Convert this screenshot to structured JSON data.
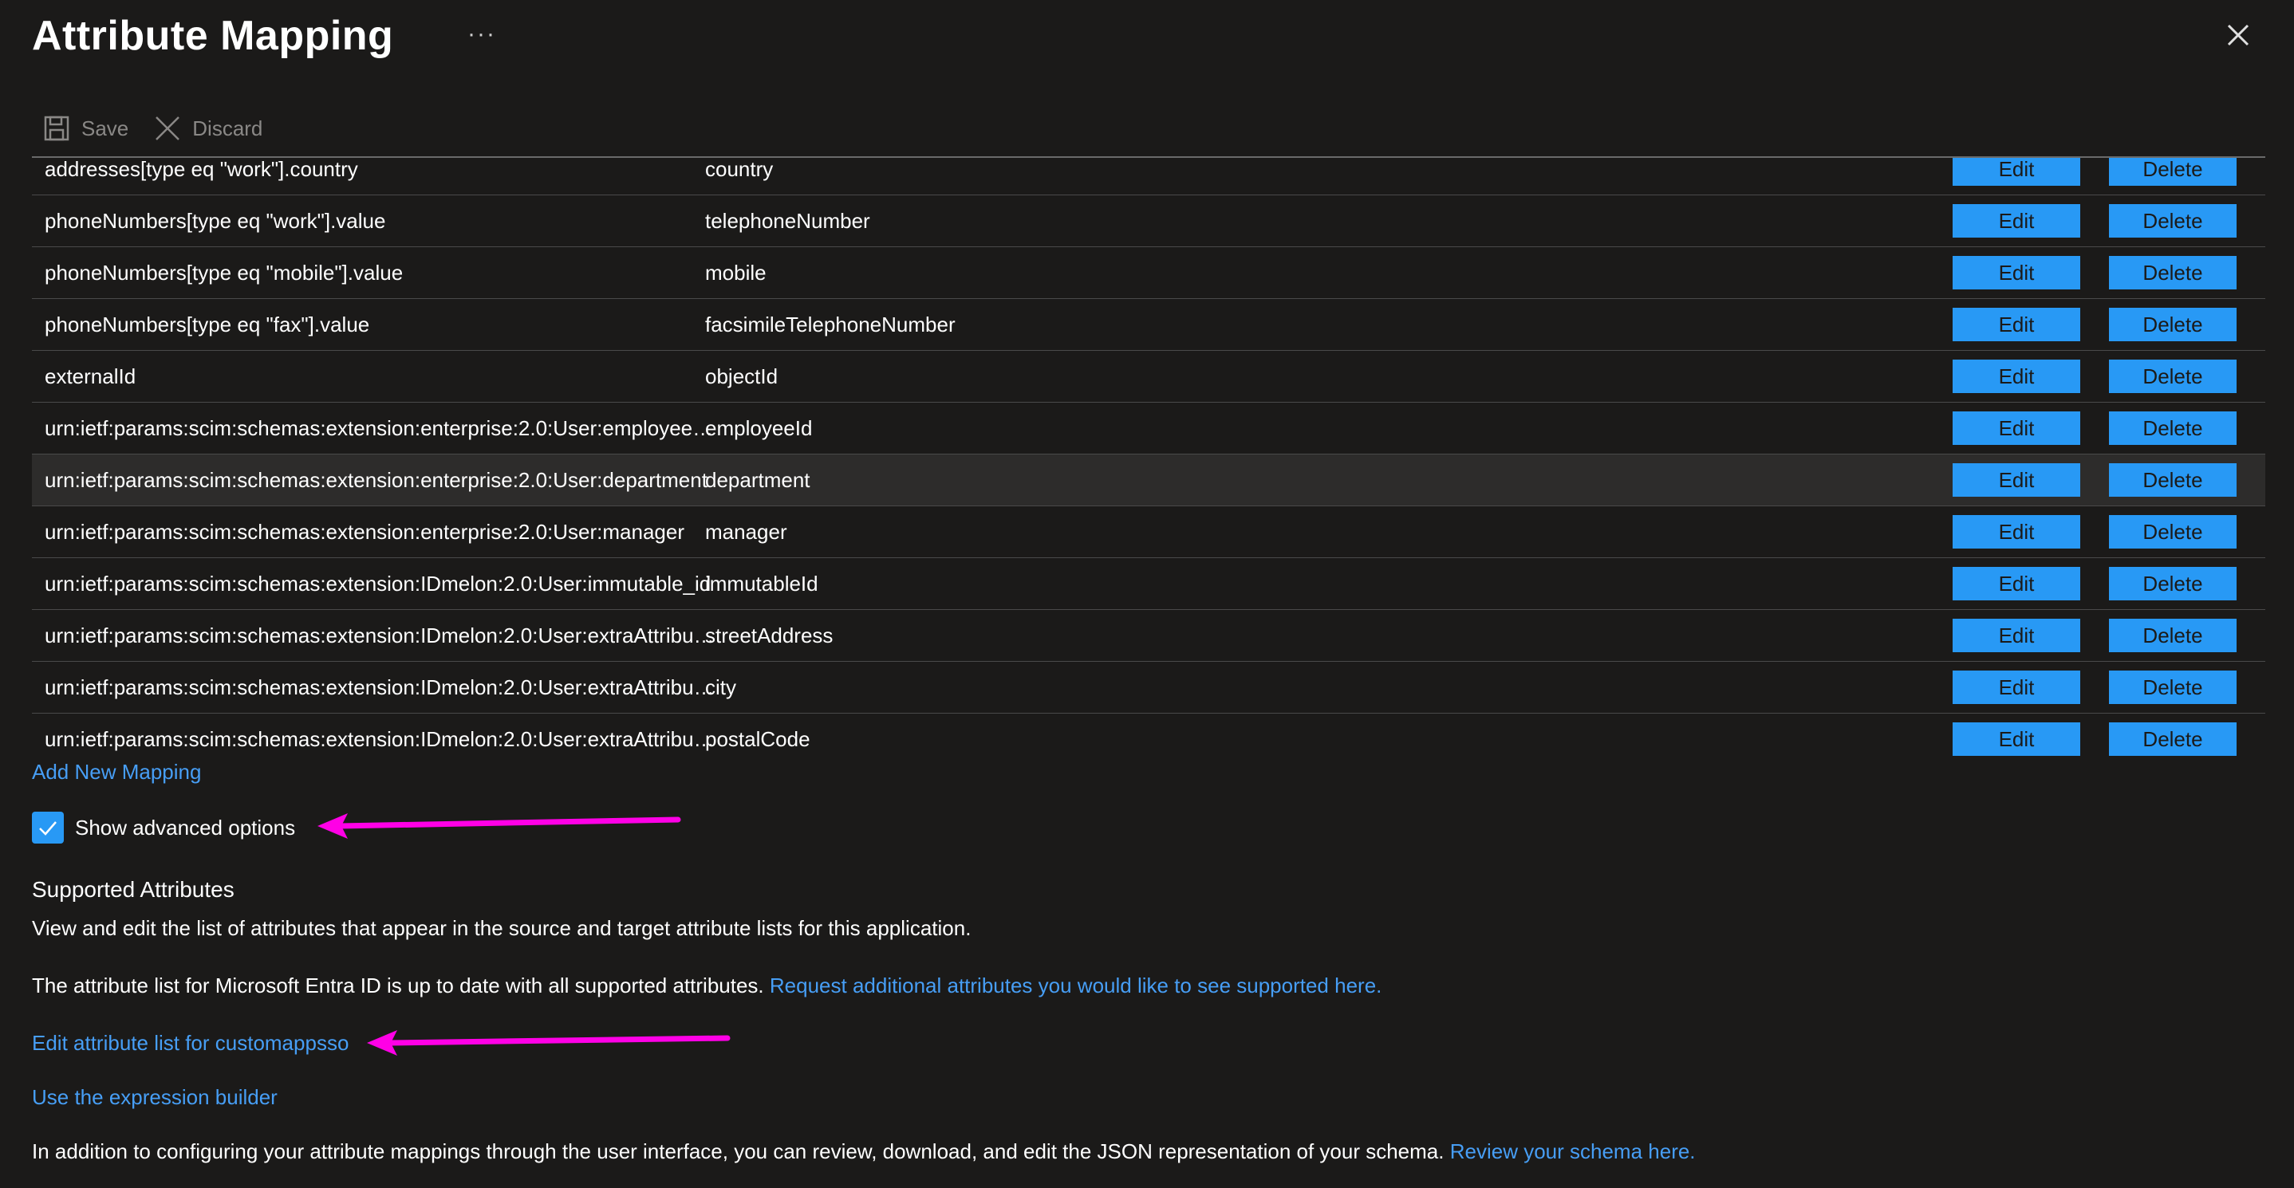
{
  "header": {
    "title": "Attribute Mapping",
    "more_label": "···"
  },
  "toolbar": {
    "save_label": "Save",
    "discard_label": "Discard"
  },
  "mappings": {
    "edit_label": "Edit",
    "delete_label": "Delete",
    "rows": [
      {
        "source": "addresses[type eq \"work\"].country",
        "target": "country"
      },
      {
        "source": "phoneNumbers[type eq \"work\"].value",
        "target": "telephoneNumber"
      },
      {
        "source": "phoneNumbers[type eq \"mobile\"].value",
        "target": "mobile"
      },
      {
        "source": "phoneNumbers[type eq \"fax\"].value",
        "target": "facsimileTelephoneNumber"
      },
      {
        "source": "externalId",
        "target": "objectId"
      },
      {
        "source": "urn:ietf:params:scim:schemas:extension:enterprise:2.0:User:employee…",
        "target": "employeeId"
      },
      {
        "source": "urn:ietf:params:scim:schemas:extension:enterprise:2.0:User:department",
        "target": "department"
      },
      {
        "source": "urn:ietf:params:scim:schemas:extension:enterprise:2.0:User:manager",
        "target": "manager"
      },
      {
        "source": "urn:ietf:params:scim:schemas:extension:IDmelon:2.0:User:immutable_id",
        "target": "immutableId"
      },
      {
        "source": "urn:ietf:params:scim:schemas:extension:IDmelon:2.0:User:extraAttribu…",
        "target": "streetAddress"
      },
      {
        "source": "urn:ietf:params:scim:schemas:extension:IDmelon:2.0:User:extraAttribu…",
        "target": "city"
      },
      {
        "source": "urn:ietf:params:scim:schemas:extension:IDmelon:2.0:User:extraAttribu…",
        "target": "postalCode"
      }
    ],
    "add_new_label": "Add New Mapping"
  },
  "advanced": {
    "checkbox_label": "Show advanced options",
    "checked": true
  },
  "supported": {
    "title": "Supported Attributes",
    "description": "View and edit the list of attributes that appear in the source and target attribute lists for this application.",
    "status_text": "The attribute list for Microsoft Entra ID is up to date with all supported attributes.",
    "request_link": "Request additional attributes you would like to see supported here.",
    "edit_list_link": "Edit attribute list for customappsso",
    "expression_link": "Use the expression builder",
    "json_text": "In addition to configuring your attribute mappings through the user interface, you can review, download, and edit the JSON representation of your schema.",
    "review_link": "Review your schema here."
  },
  "colors": {
    "background": "#1b1a19",
    "accent": "#2899f5",
    "link": "#479ef5",
    "annotation_arrow": "#ff00e6"
  }
}
